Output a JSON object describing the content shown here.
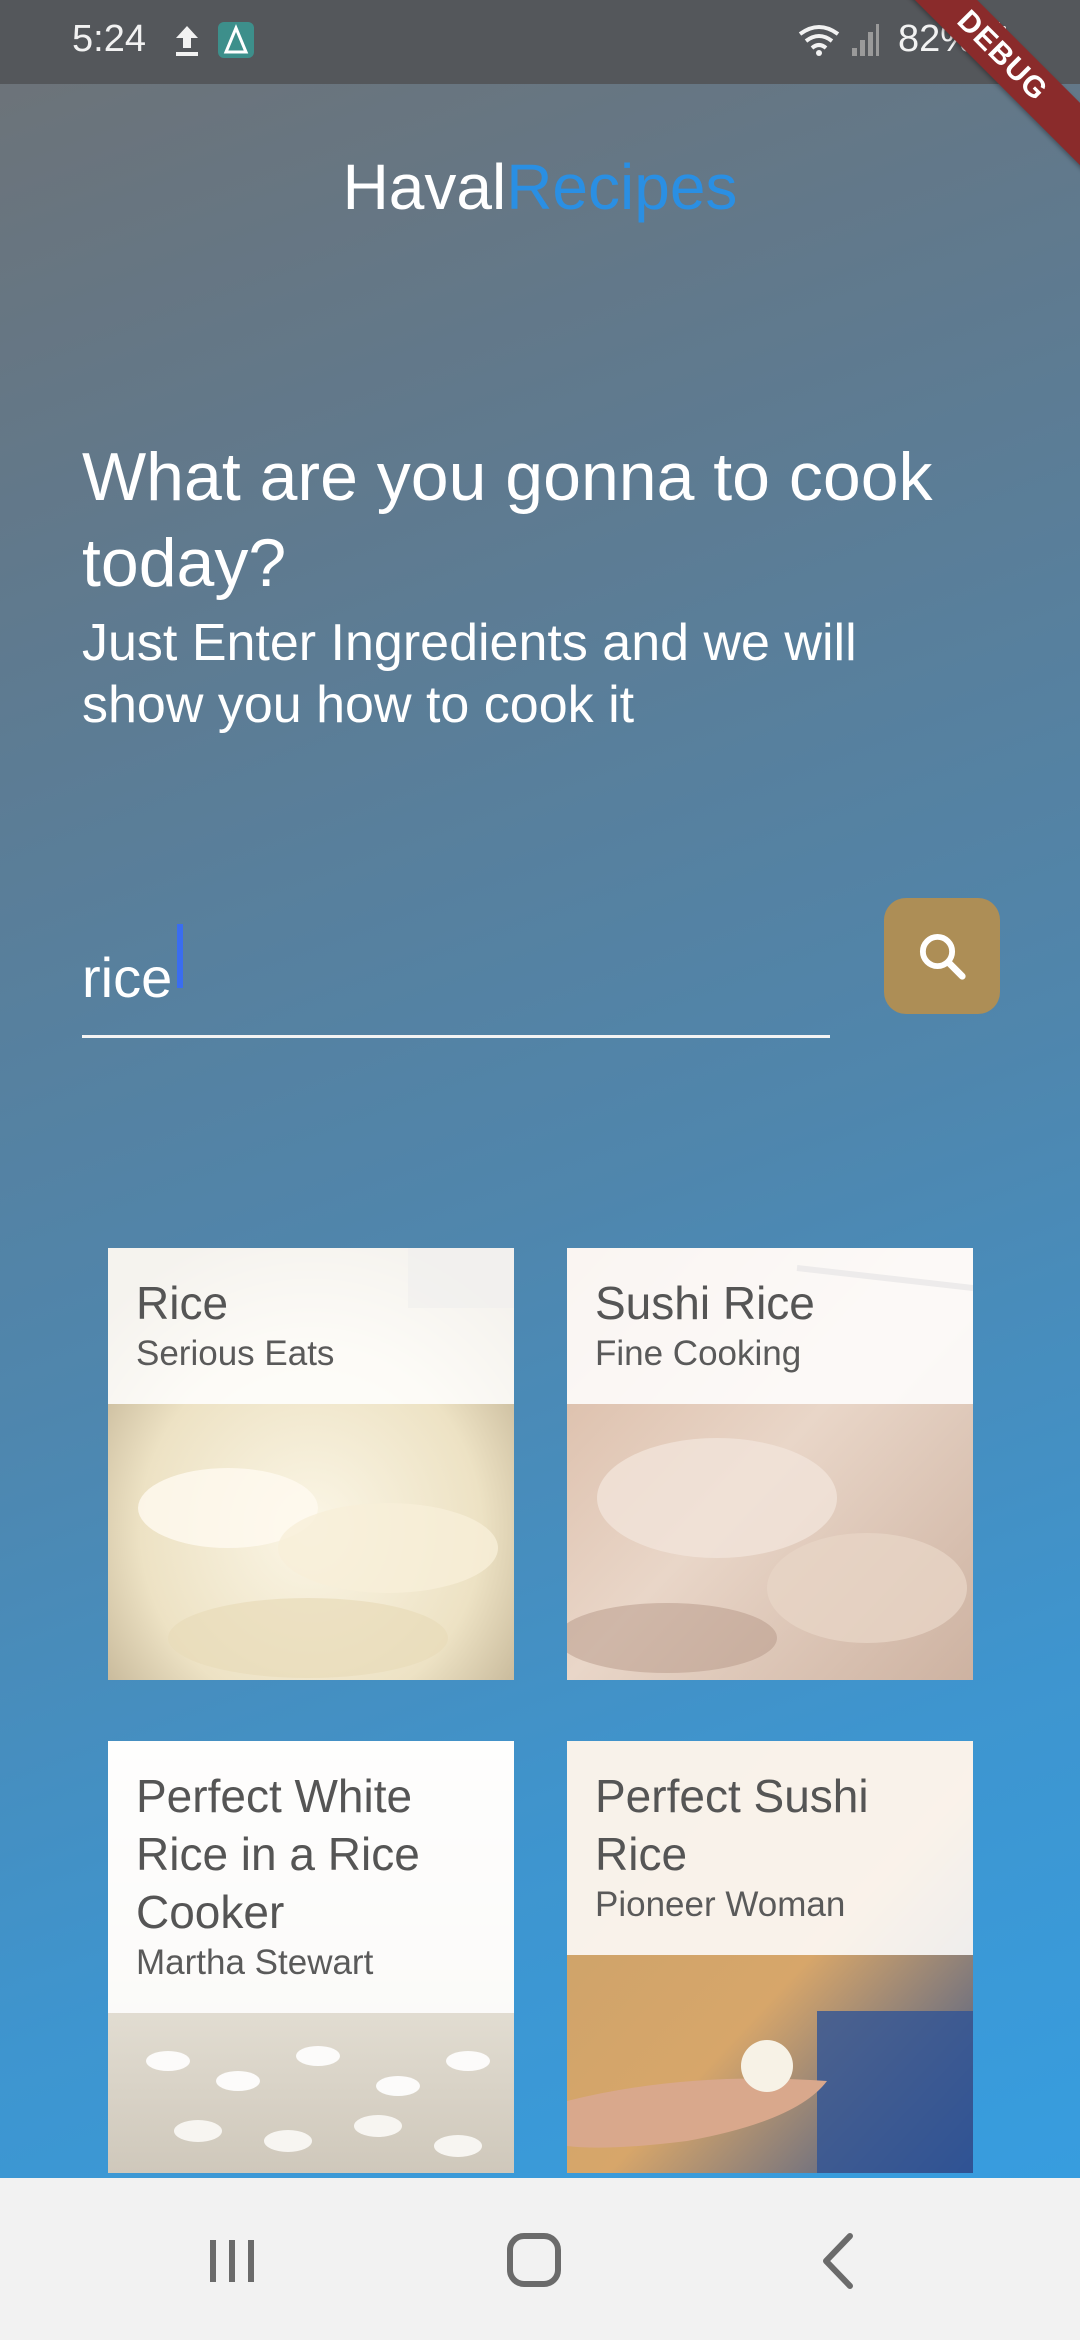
{
  "status_bar": {
    "time": "5:24",
    "battery": "82%",
    "icons": [
      "upload-icon",
      "app-notification-icon",
      "wifi-icon",
      "signal-icon",
      "battery-icon"
    ]
  },
  "debug_banner": "DEBUG",
  "header": {
    "title_part1": "Haval",
    "title_part2": "Recipes",
    "accent_color": "#2a8fe3"
  },
  "intro": {
    "headline": "What are you gonna to cook today?",
    "subline": "Just Enter Ingredients and we will show you how to cook it"
  },
  "search": {
    "value": "rice",
    "button_icon": "search-icon",
    "button_color": "#ad8e56"
  },
  "recipes": [
    {
      "title": "Rice",
      "source": "Serious Eats"
    },
    {
      "title": "Sushi Rice",
      "source": "Fine Cooking"
    },
    {
      "title": "Perfect White Rice in a Rice Cooker",
      "source": "Martha Stewart"
    },
    {
      "title": "Perfect Sushi Rice",
      "source": "Pioneer Woman"
    }
  ],
  "nav_bar": {
    "icons": [
      "recent-apps-icon",
      "home-icon",
      "back-icon"
    ]
  }
}
